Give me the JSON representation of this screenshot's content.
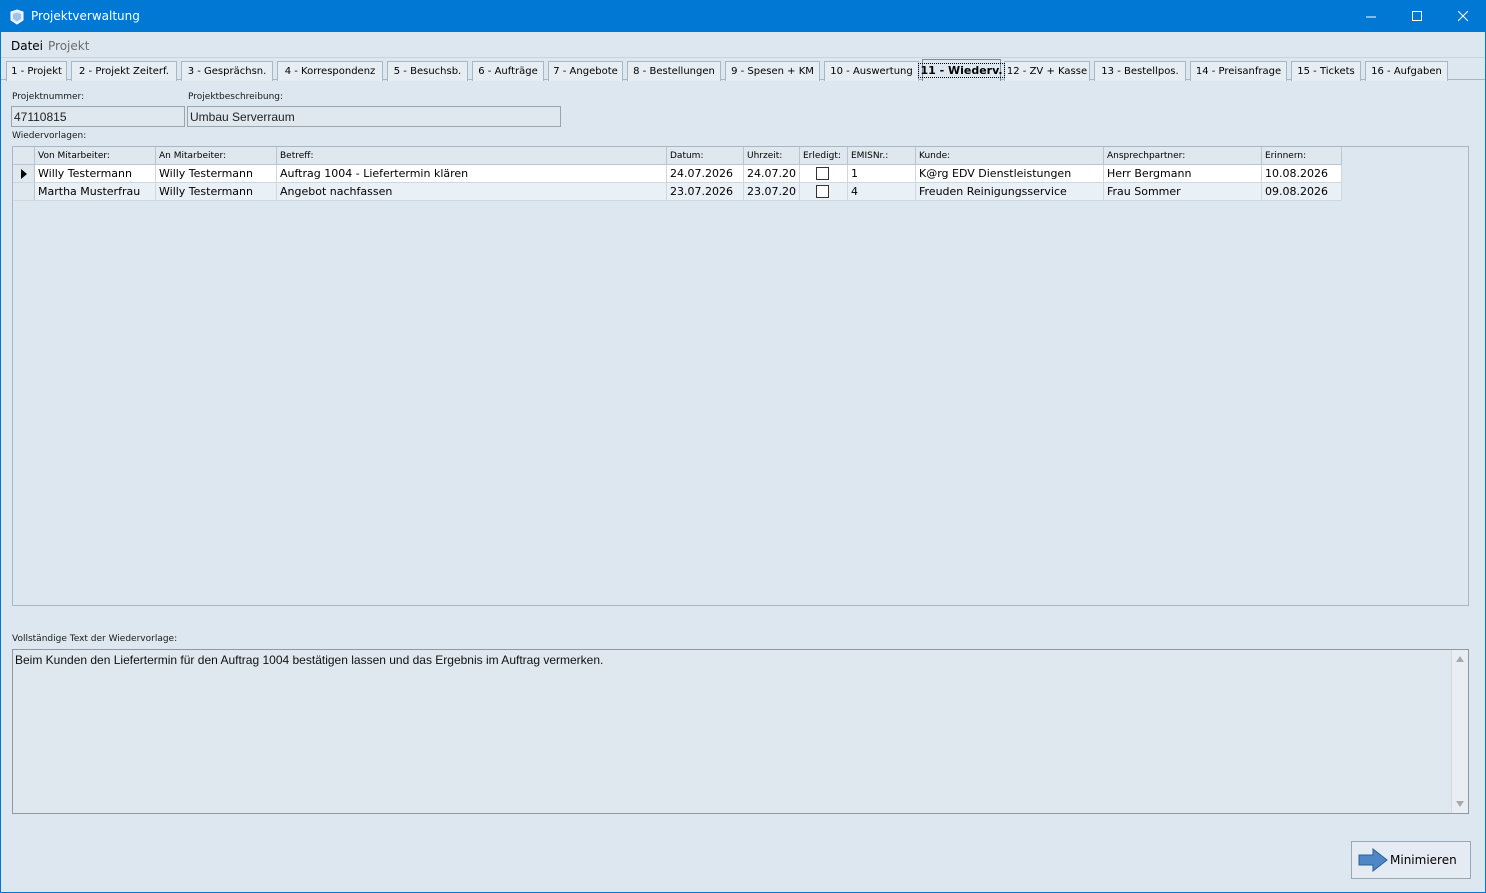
{
  "window": {
    "title": "Projektverwaltung"
  },
  "menu": {
    "datei": "Datei",
    "projekt": "Projekt"
  },
  "tabs": [
    {
      "label": "1 - Projekt"
    },
    {
      "label": "2 - Projekt Zeiterf."
    },
    {
      "label": "3 - Gesprächsn."
    },
    {
      "label": "4 - Korrespondenz"
    },
    {
      "label": "5 - Besuchsb."
    },
    {
      "label": "6 - Aufträge"
    },
    {
      "label": "7 - Angebote"
    },
    {
      "label": "8 - Bestellungen"
    },
    {
      "label": "9 - Spesen + KM"
    },
    {
      "label": "10 - Auswertung"
    },
    {
      "label": "11 - Wiederv."
    },
    {
      "label": "12 - ZV + Kasse"
    },
    {
      "label": "13 - Bestellpos."
    },
    {
      "label": "14 - Preisanfrage"
    },
    {
      "label": "15 - Tickets"
    },
    {
      "label": "16 - Aufgaben"
    }
  ],
  "project": {
    "nummer_label": "Projektnummer:",
    "nummer": "47110815",
    "beschreibung_label": "Projektbeschreibung:",
    "beschreibung": "Umbau Serverraum"
  },
  "grid": {
    "label": "Wiedervorlagen:",
    "columns": [
      "Von Mitarbeiter:",
      "An Mitarbeiter:",
      "Betreff:",
      "Datum:",
      "Uhrzeit:",
      "Erledigt:",
      "EMISNr.:",
      "Kunde:",
      "Ansprechpartner:",
      "Erinnern:"
    ],
    "rows": [
      {
        "von": "Willy Testermann",
        "an": "Willy Testermann",
        "betreff": "Auftrag 1004 - Liefertermin klären",
        "datum": "24.07.2026",
        "uhrzeit": "24.07.20",
        "erledigt": false,
        "emis": "1",
        "kunde": "K@rg EDV Dienstleistungen",
        "ansprech": "Herr Bergmann",
        "erinnern": "10.08.2026"
      },
      {
        "von": "Martha Musterfrau",
        "an": "Willy Testermann",
        "betreff": "Angebot nachfassen",
        "datum": "23.07.2026",
        "uhrzeit": "23.07.20",
        "erledigt": false,
        "emis": "4",
        "kunde": "Freuden Reinigungsservice",
        "ansprech": "Frau Sommer",
        "erinnern": "09.08.2026"
      }
    ]
  },
  "memo": {
    "label": "Vollständige Text der Wiedervorlage:",
    "text": "Beim Kunden den Liefertermin für den Auftrag 1004 bestätigen lassen und das Ergebnis im Auftrag vermerken."
  },
  "buttons": {
    "minimize": "Minimieren"
  },
  "colors": {
    "titlebar": "#0078d4",
    "background": "#dde7f0",
    "arrow": "#4f86c6"
  }
}
